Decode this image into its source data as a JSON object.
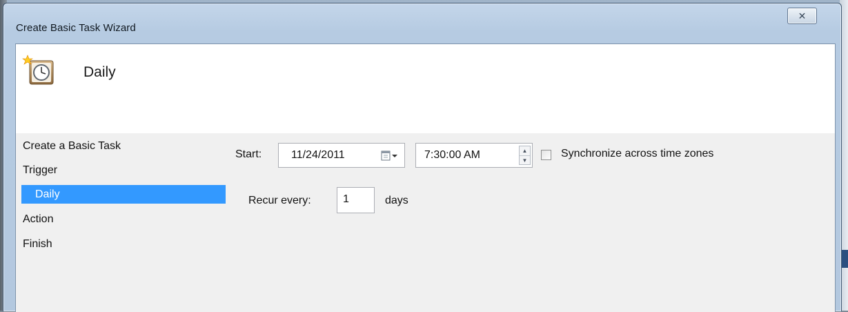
{
  "window": {
    "title": "Create Basic Task Wizard",
    "close_glyph": "✕"
  },
  "header": {
    "icon": "task-scheduler-clock-icon",
    "title": "Daily"
  },
  "nav": {
    "items": [
      {
        "label": "Create a Basic Task",
        "selected": false
      },
      {
        "label": "Trigger",
        "selected": false
      },
      {
        "label": "Daily",
        "selected": true
      },
      {
        "label": "Action",
        "selected": false
      },
      {
        "label": "Finish",
        "selected": false
      }
    ]
  },
  "form": {
    "start_label": "Start:",
    "start_date": "11/24/2011",
    "start_time": "7:30:00 AM",
    "sync_label": "Synchronize across time zones",
    "sync_checked": false,
    "recur_label": "Recur every:",
    "recur_value": "1",
    "recur_unit": "days"
  },
  "colors": {
    "selection": "#3399ff",
    "titlebar": "#b6cbe2",
    "panel": "#f0f0f0"
  }
}
